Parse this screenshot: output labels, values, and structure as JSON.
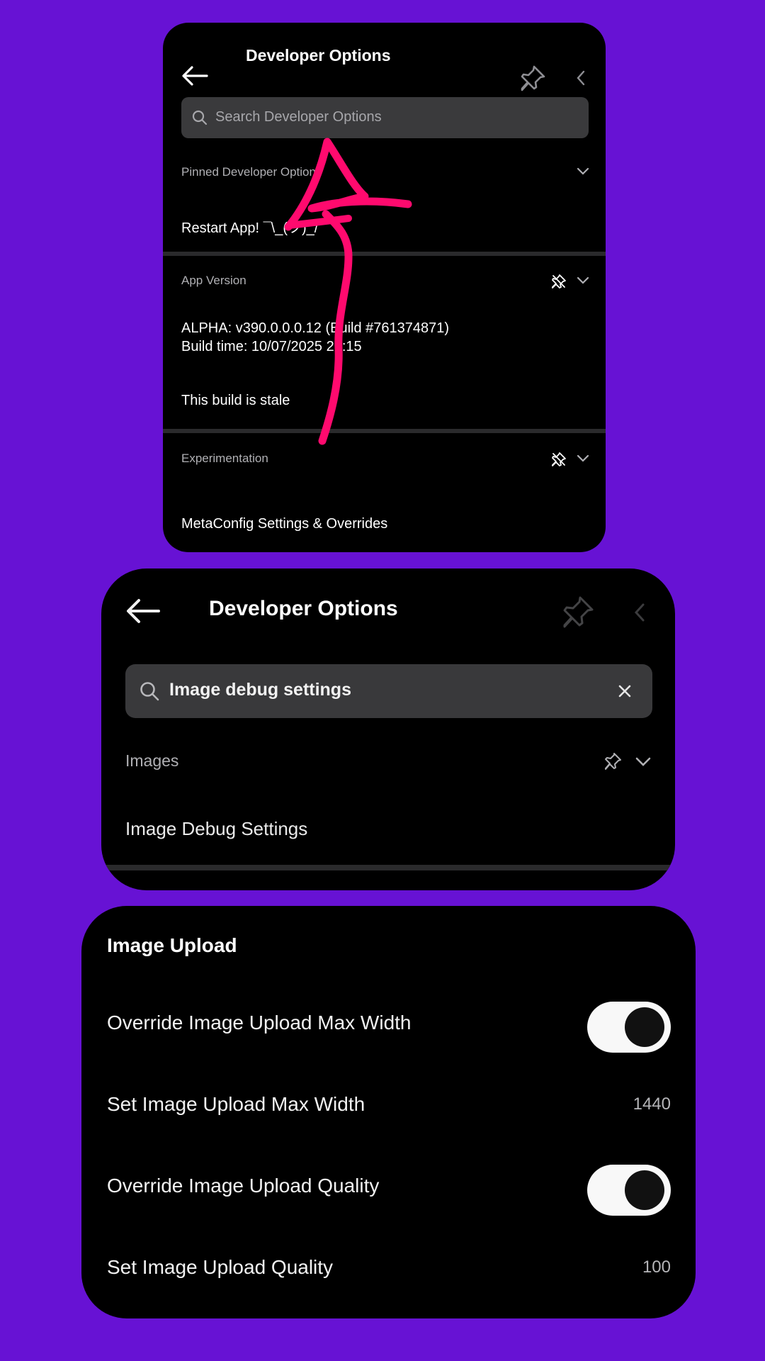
{
  "panel1": {
    "title": "Developer Options",
    "search_placeholder": "Search Developer Options",
    "pinned_section": "Pinned Developer Options",
    "restart_item": "Restart App! ¯\\_(ツ)_/¯",
    "app_version_section": "App Version",
    "version_line1": "ALPHA: v390.0.0.0.12 (Build #761374871)",
    "version_line2": "Build time: 10/07/2025 21:15",
    "stale_item": "This build is stale",
    "experimentation_section": "Experimentation",
    "metaconfig_item": "MetaConfig Settings & Overrides"
  },
  "panel2": {
    "title": "Developer Options",
    "search_value": "Image debug settings",
    "images_section": "Images",
    "image_debug_item": "Image Debug Settings"
  },
  "panel3": {
    "header": "Image Upload",
    "rows": [
      {
        "label": "Override Image Upload Max Width",
        "toggle_on": true
      },
      {
        "label": "Set Image Upload Max Width",
        "value": "1440"
      },
      {
        "label": "Override Image Upload Quality",
        "toggle_on": true
      },
      {
        "label": "Set Image Upload Quality",
        "value": "100"
      }
    ]
  },
  "annotation": {
    "color": "#ff0a6e",
    "icon": "arrow-up-drawing"
  }
}
